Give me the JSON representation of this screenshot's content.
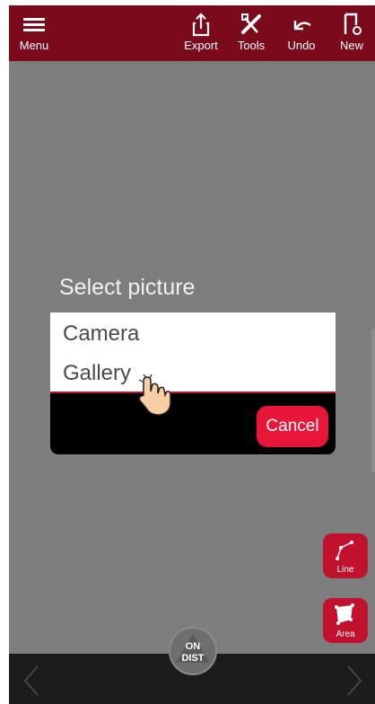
{
  "toolbar": {
    "menu_label": "Menu",
    "export_label": "Export",
    "tools_label": "Tools",
    "undo_label": "Undo",
    "new_label": "New"
  },
  "dialog": {
    "title": "Select picture",
    "options": [
      "Camera",
      "Gallery"
    ],
    "cancel_label": "Cancel"
  },
  "side_tools": {
    "line_label": "Line",
    "area_label": "Area"
  },
  "center_button": {
    "top_label": "ON",
    "bottom_label": "DIST"
  },
  "colors": {
    "toolbar": "#7a0a1c",
    "accent": "#e8173a",
    "fab": "#c2102f"
  }
}
